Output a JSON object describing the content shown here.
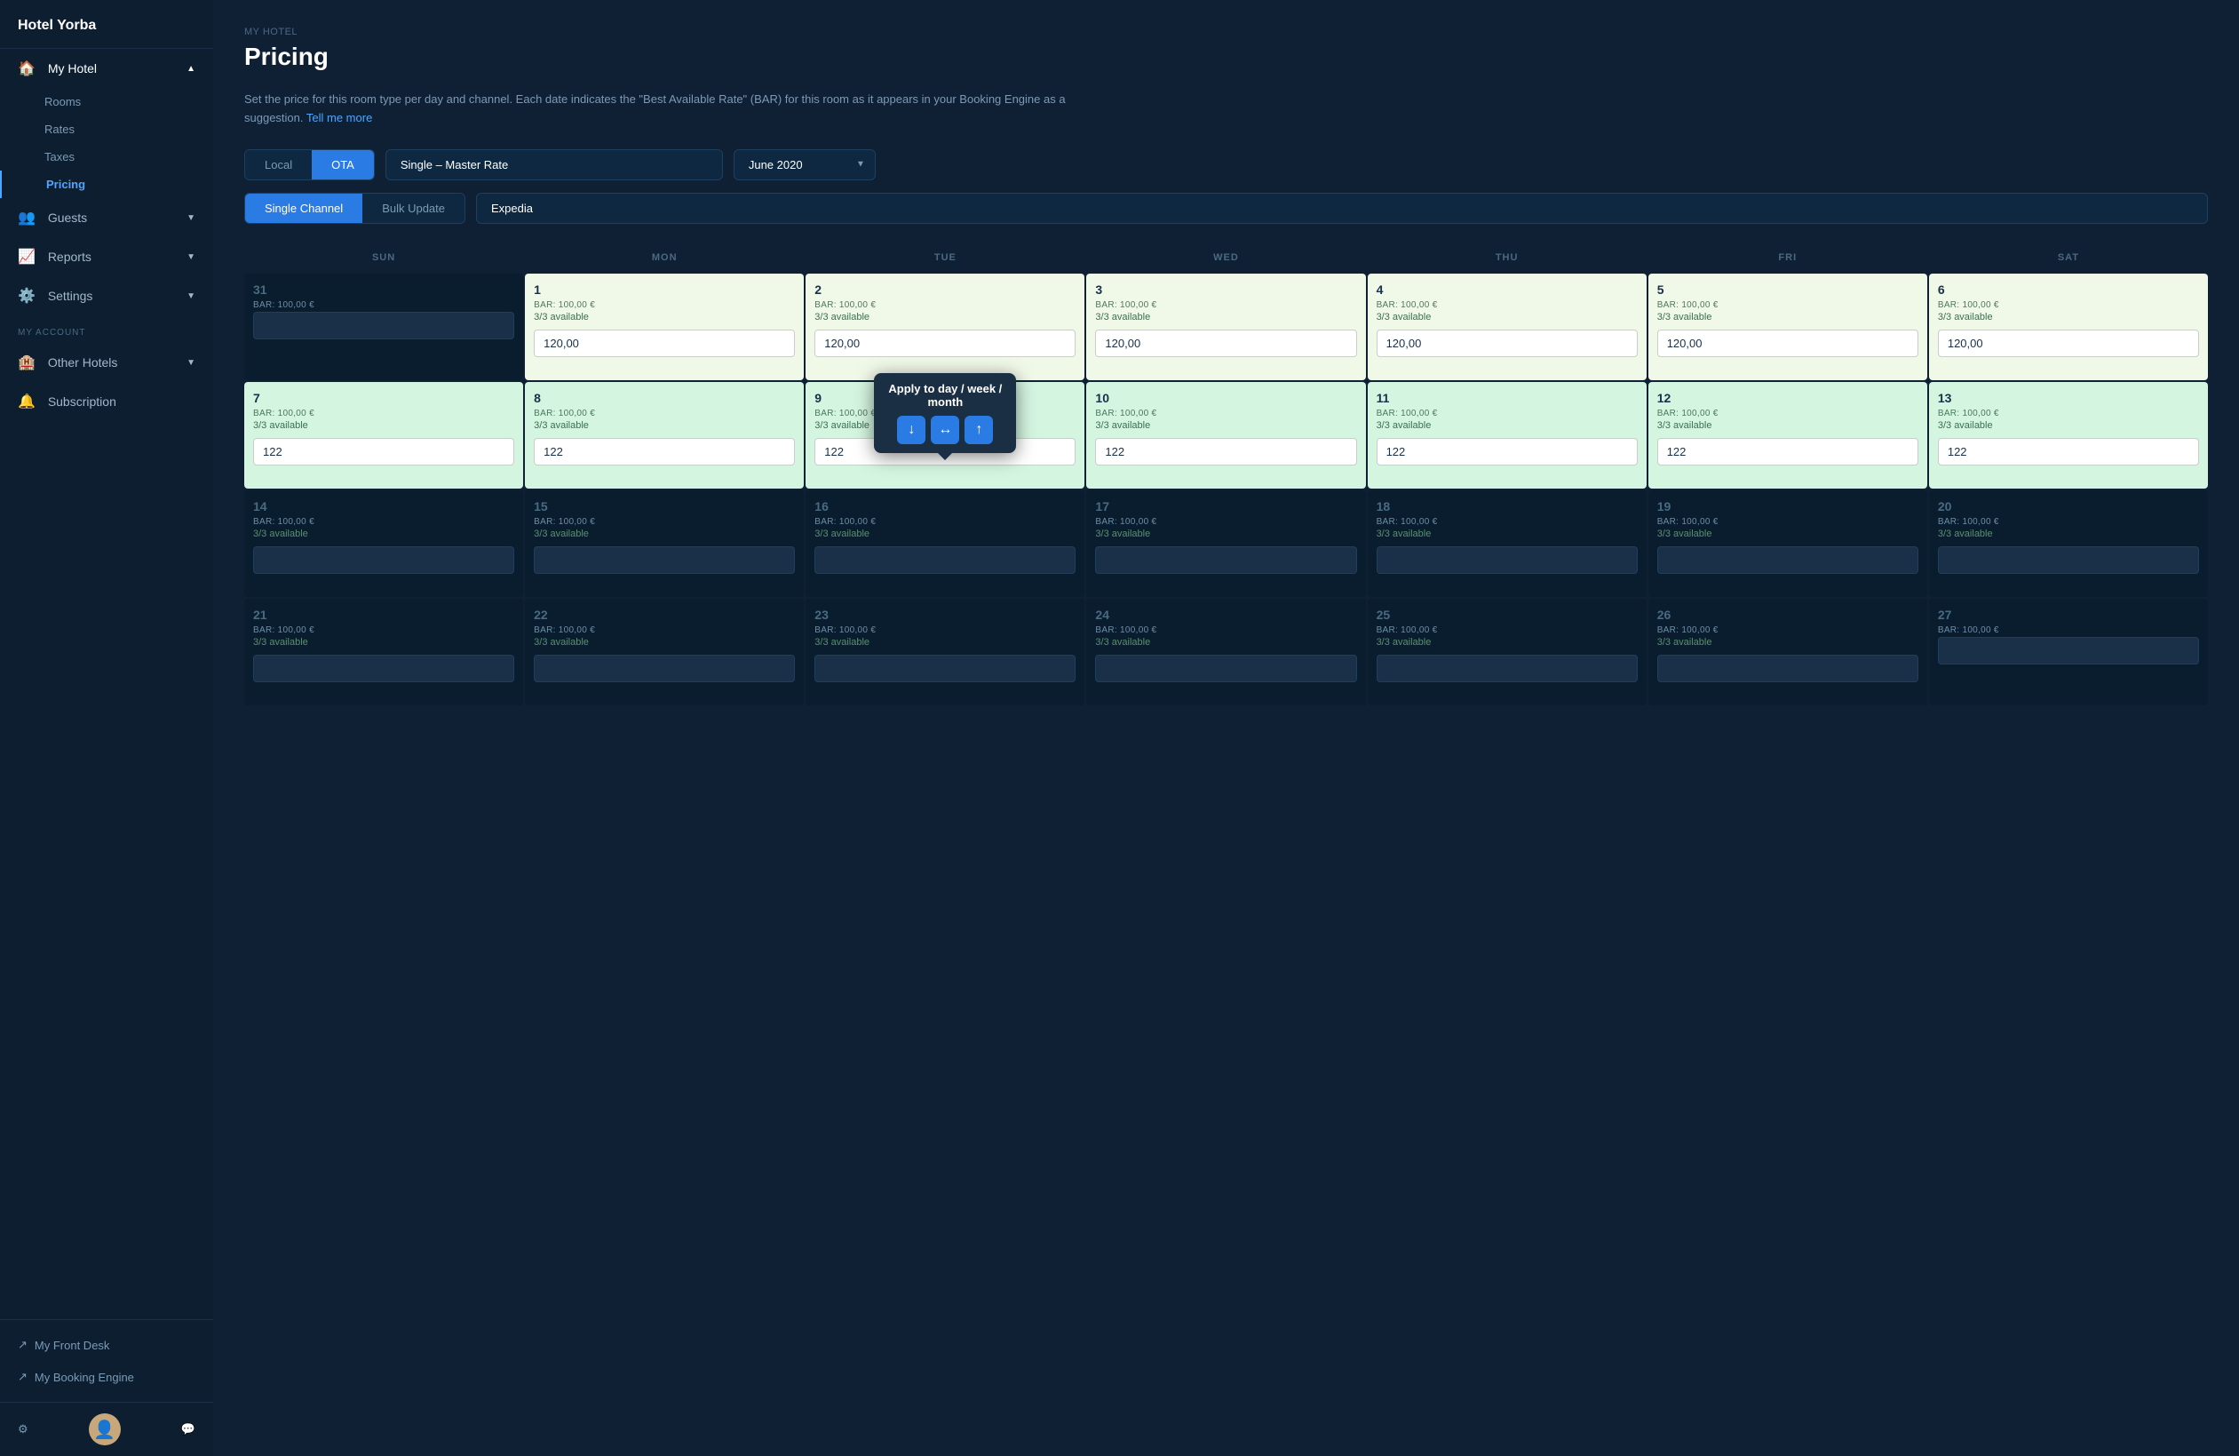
{
  "sidebar": {
    "hotel_name": "Hotel Yorba",
    "my_hotel_label": "My Hotel",
    "rooms_label": "Rooms",
    "rates_label": "Rates",
    "taxes_label": "Taxes",
    "pricing_label": "Pricing",
    "guests_label": "Guests",
    "reports_label": "Reports",
    "settings_label": "Settings",
    "account_label": "MY ACCOUNT",
    "other_hotels_label": "Other Hotels",
    "subscription_label": "Subscription",
    "front_desk_label": "My Front Desk",
    "booking_engine_label": "My Booking Engine"
  },
  "breadcrumb": "MY HOTEL",
  "page_title": "Pricing",
  "description_text": "Set the price for this room type per day and channel. Each date indicates the \"Best Available Rate\" (BAR) for this room as it appears in your Booking Engine as a suggestion.",
  "description_link": "Tell me more",
  "local_label": "Local",
  "ota_label": "OTA",
  "rate_value": "Single – Master Rate",
  "month_value": "June 2020",
  "single_channel_label": "Single Channel",
  "bulk_update_label": "Bulk Update",
  "channel_value": "Expedia",
  "days": [
    "SUN",
    "MON",
    "TUE",
    "WED",
    "THU",
    "FRI",
    "SAT"
  ],
  "calendar": {
    "weeks": [
      [
        {
          "num": "31",
          "bar": "BAR: 100,00 €",
          "avail": "",
          "value": "",
          "type": "dim"
        },
        {
          "num": "1",
          "bar": "BAR: 100,00 €",
          "avail": "3/3 available",
          "value": "120,00",
          "type": "highlighted"
        },
        {
          "num": "2",
          "bar": "BAR: 100,00 €",
          "avail": "3/3 available",
          "value": "120,00",
          "type": "highlighted"
        },
        {
          "num": "3",
          "bar": "BAR: 100,00 €",
          "avail": "3/3 available",
          "value": "120,00",
          "type": "highlighted"
        },
        {
          "num": "4",
          "bar": "BAR: 100,00 €",
          "avail": "3/3 available",
          "value": "120,00",
          "type": "highlighted"
        },
        {
          "num": "5",
          "bar": "BAR: 100,00 €",
          "avail": "3/3 available",
          "value": "120,00",
          "type": "highlighted"
        },
        {
          "num": "6",
          "bar": "BAR: 100,00 €",
          "avail": "3/3 available",
          "value": "120,00",
          "type": "highlighted"
        }
      ],
      [
        {
          "num": "7",
          "bar": "BAR: 100,00 €",
          "avail": "3/3 available",
          "value": "122",
          "type": "highlighted-green"
        },
        {
          "num": "8",
          "bar": "BAR: 100,00 €",
          "avail": "3/3 available",
          "value": "122",
          "type": "highlighted-green"
        },
        {
          "num": "9",
          "bar": "BAR: 100,00 €",
          "avail": "3/3 available",
          "value": "122",
          "type": "highlighted-green",
          "tooltip": true
        },
        {
          "num": "10",
          "bar": "BAR: 100,00 €",
          "avail": "3/3 available",
          "value": "122",
          "type": "highlighted-green"
        },
        {
          "num": "11",
          "bar": "BAR: 100,00 €",
          "avail": "3/3 available",
          "value": "122",
          "type": "highlighted-green"
        },
        {
          "num": "12",
          "bar": "BAR: 100,00 €",
          "avail": "3/3 available",
          "value": "122",
          "type": "highlighted-green"
        },
        {
          "num": "13",
          "bar": "BAR: 100,00 €",
          "avail": "3/3 available",
          "value": "122",
          "type": "highlighted-green"
        }
      ],
      [
        {
          "num": "14",
          "bar": "BAR: 100,00 €",
          "avail": "3/3 available",
          "value": "",
          "type": "dim"
        },
        {
          "num": "15",
          "bar": "BAR: 100,00 €",
          "avail": "3/3 available",
          "value": "",
          "type": "dim"
        },
        {
          "num": "16",
          "bar": "BAR: 100,00 €",
          "avail": "3/3 available",
          "value": "",
          "type": "dim"
        },
        {
          "num": "17",
          "bar": "BAR: 100,00 €",
          "avail": "3/3 available",
          "value": "",
          "type": "dim"
        },
        {
          "num": "18",
          "bar": "BAR: 100,00 €",
          "avail": "3/3 available",
          "value": "",
          "type": "dim"
        },
        {
          "num": "19",
          "bar": "BAR: 100,00 €",
          "avail": "3/3 available",
          "value": "",
          "type": "dim"
        },
        {
          "num": "20",
          "bar": "BAR: 100,00 €",
          "avail": "3/3 available",
          "value": "",
          "type": "dim"
        }
      ],
      [
        {
          "num": "21",
          "bar": "BAR: 100,00 €",
          "avail": "3/3 available",
          "value": "",
          "type": "dim"
        },
        {
          "num": "22",
          "bar": "BAR: 100,00 €",
          "avail": "3/3 available",
          "value": "",
          "type": "dim"
        },
        {
          "num": "23",
          "bar": "BAR: 100,00 €",
          "avail": "3/3 available",
          "value": "",
          "type": "dim"
        },
        {
          "num": "24",
          "bar": "BAR: 100,00 €",
          "avail": "3/3 available",
          "value": "",
          "type": "dim"
        },
        {
          "num": "25",
          "bar": "BAR: 100,00 €",
          "avail": "3/3 available",
          "value": "",
          "type": "dim"
        },
        {
          "num": "26",
          "bar": "BAR: 100,00 €",
          "avail": "3/3 available",
          "value": "",
          "type": "dim"
        },
        {
          "num": "27",
          "bar": "BAR: 100,00 €",
          "avail": "",
          "value": "",
          "type": "dim"
        }
      ]
    ]
  },
  "tooltip": {
    "title": "Apply to day / week / month",
    "btn_down": "↓",
    "btn_arrows": "↔",
    "btn_up": "↑"
  }
}
